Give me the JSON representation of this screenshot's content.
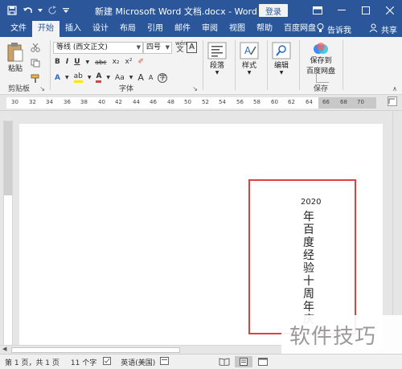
{
  "titlebar": {
    "title": "新建 Microsoft Word 文档.docx - Word",
    "login": "登录"
  },
  "tabs": [
    "文件",
    "开始",
    "插入",
    "设计",
    "布局",
    "引用",
    "邮件",
    "审阅",
    "视图",
    "帮助",
    "百度网盘"
  ],
  "tab_right": {
    "tell": "告诉我",
    "share": "共享"
  },
  "ribbon": {
    "clipboard": {
      "paste": "粘贴",
      "label": "剪贴板"
    },
    "font": {
      "family": "等线 (西文正文)",
      "size": "四号",
      "wen": "wén\n文",
      "bold": "B",
      "italic": "I",
      "underline": "U",
      "strike": "abc",
      "sub": "x₂",
      "sup": "x²",
      "big": "A",
      "small": "A",
      "aa": "Aa",
      "label": "字体"
    },
    "paragraph": {
      "label": "段落"
    },
    "styles": {
      "label": "样式"
    },
    "editing": {
      "label": "编辑"
    },
    "save": {
      "line1": "保存到",
      "line2": "百度网盘",
      "label": "保存"
    }
  },
  "ruler": [
    "30",
    "32",
    "34",
    "36",
    "38",
    "40",
    "42",
    "44",
    "46",
    "48",
    "50",
    "52",
    "54",
    "56",
    "58",
    "60",
    "62",
    "64",
    "66",
    "68",
    "70",
    "72"
  ],
  "document": {
    "year": "2020",
    "vertical_text": "年百度经验十周年庆"
  },
  "statusbar": {
    "page": "第 1 页，共 1 页",
    "words": "11 个字",
    "lang": "英语(美国)"
  },
  "watermark": "软件技巧",
  "colors": {
    "accent": "#2b579a",
    "textbox_border": "#e0403e"
  }
}
